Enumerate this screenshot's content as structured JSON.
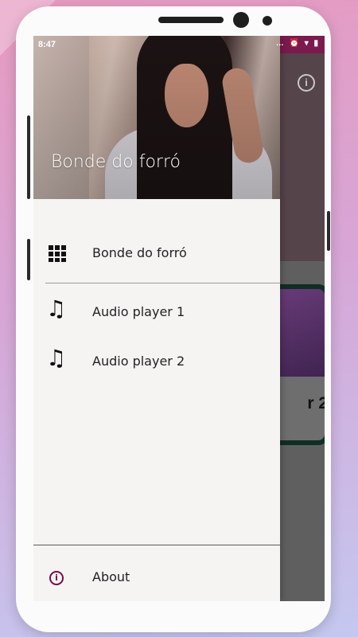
{
  "status_bar": {
    "time": "8:47",
    "icons": "… ⏰ ▾ ▮"
  },
  "drawer": {
    "header_title": "Bonde do forró",
    "items": [
      {
        "label": "Bonde do forró",
        "icon": "grid-icon"
      },
      {
        "label": "Audio player 1",
        "icon": "music-note-icon"
      },
      {
        "label": "Audio player 2",
        "icon": "music-note-icon"
      }
    ],
    "footer_item": {
      "label": "About",
      "icon": "info-icon"
    }
  },
  "background_app": {
    "card_label_fragment": "r 2",
    "info_icon": "info-icon"
  },
  "colors": {
    "accent": "#7a0a48",
    "drawer_bg": "#f6f4f3",
    "card_border": "#0f2e24"
  }
}
